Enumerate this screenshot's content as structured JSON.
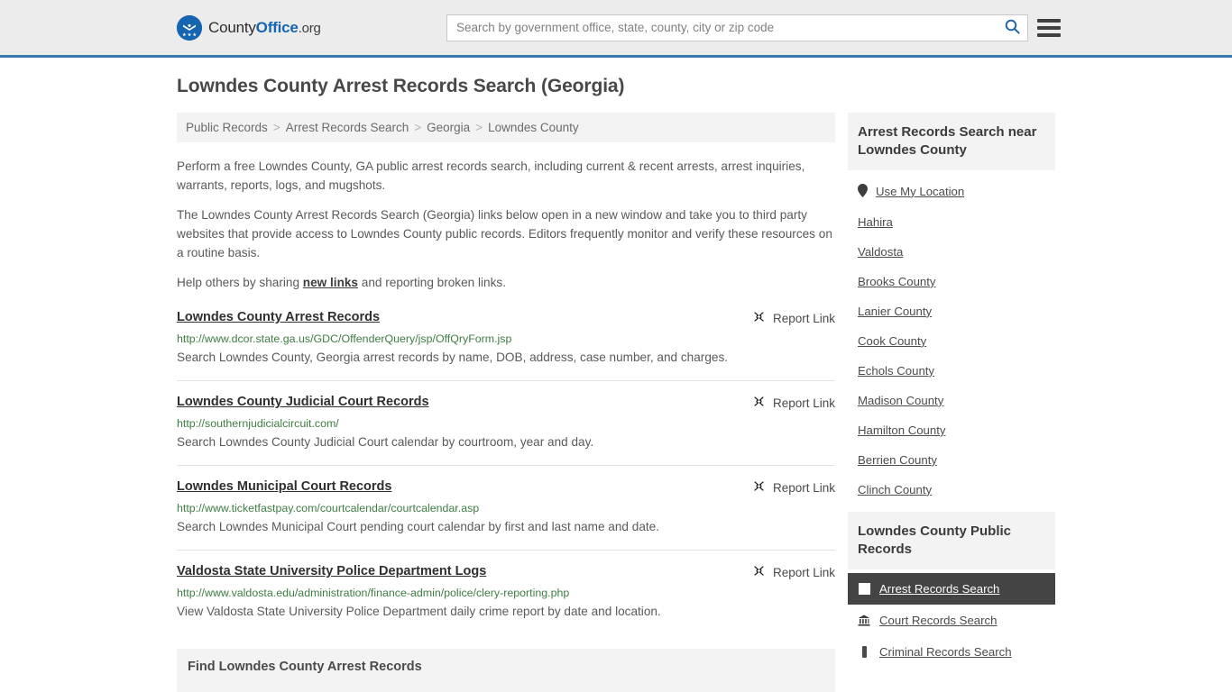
{
  "header": {
    "logo": {
      "part1": "County",
      "part2": "Office",
      "part3": ".org",
      "icon": "eagle-seal-icon"
    },
    "search": {
      "placeholder": "Search by government office, state, county, city or zip code",
      "value": "",
      "icon": "search-icon"
    },
    "menu_icon": "hamburger-menu-icon",
    "accent_color": "#1565b0",
    "border_color": "#3a7ab0",
    "background": "#ececec"
  },
  "main": {
    "title": "Lowndes County Arrest Records Search (Georgia)",
    "breadcrumb": [
      "Public Records",
      "Arrest Records Search",
      "Georgia",
      "Lowndes County"
    ],
    "breadcrumb_separator": ">",
    "intro_paragraphs": [
      "Perform a free Lowndes County, GA public arrest records search, including current & recent arrests, arrest inquiries, warrants, reports, logs, and mugshots.",
      "The Lowndes County Arrest Records Search (Georgia) links below open in a new window and take you to third party websites that provide access to Lowndes County public records. Editors frequently monitor and verify these resources on a routine basis."
    ],
    "help_prefix": "Help others by sharing ",
    "help_link": "new links",
    "help_suffix": " and reporting broken links.",
    "report_link_label": "Report Link",
    "report_link_icon": "broken-link-icon",
    "results": [
      {
        "title": "Lowndes County Arrest Records",
        "url": "http://www.dcor.state.ga.us/GDC/OffenderQuery/jsp/OffQryForm.jsp",
        "description": "Search Lowndes County, Georgia arrest records by name, DOB, address, case number, and charges."
      },
      {
        "title": "Lowndes County Judicial Court Records",
        "url": "http://southernjudicialcircuit.com/",
        "description": "Search Lowndes County Judicial Court calendar by courtroom, year and day."
      },
      {
        "title": "Lowndes Municipal Court Records",
        "url": "http://www.ticketfastpay.com/courtcalendar/courtcalendar.asp",
        "description": "Search Lowndes Municipal Court pending court calendar by first and last name and date."
      },
      {
        "title": "Valdosta State University Police Department Logs",
        "url": "http://www.valdosta.edu/administration/finance-admin/police/clery-reporting.php",
        "description": "View Valdosta State University Police Department daily crime report by date and location."
      }
    ],
    "find_section_title": "Find Lowndes County Arrest Records",
    "url_color": "#3f7d44"
  },
  "sidebar": {
    "near_card": {
      "heading": "Arrest Records Search near Lowndes County",
      "items": [
        {
          "label": "Use My Location",
          "icon": "map-pin-icon"
        },
        {
          "label": "Hahira",
          "icon": ""
        },
        {
          "label": "Valdosta",
          "icon": ""
        },
        {
          "label": "Brooks County",
          "icon": ""
        },
        {
          "label": "Lanier County",
          "icon": ""
        },
        {
          "label": "Cook County",
          "icon": ""
        },
        {
          "label": "Echols County",
          "icon": ""
        },
        {
          "label": "Madison County",
          "icon": ""
        },
        {
          "label": "Hamilton County",
          "icon": ""
        },
        {
          "label": "Berrien County",
          "icon": ""
        },
        {
          "label": "Clinch County",
          "icon": ""
        }
      ]
    },
    "records_card": {
      "heading": "Lowndes County Public Records",
      "active_background": "#444444",
      "items": [
        {
          "label": "Arrest Records Search",
          "icon": "document-icon",
          "active": true
        },
        {
          "label": "Court Records Search",
          "icon": "courthouse-icon",
          "active": false
        },
        {
          "label": "Criminal Records Search",
          "icon": "fingerprint-icon",
          "active": false
        }
      ]
    }
  }
}
